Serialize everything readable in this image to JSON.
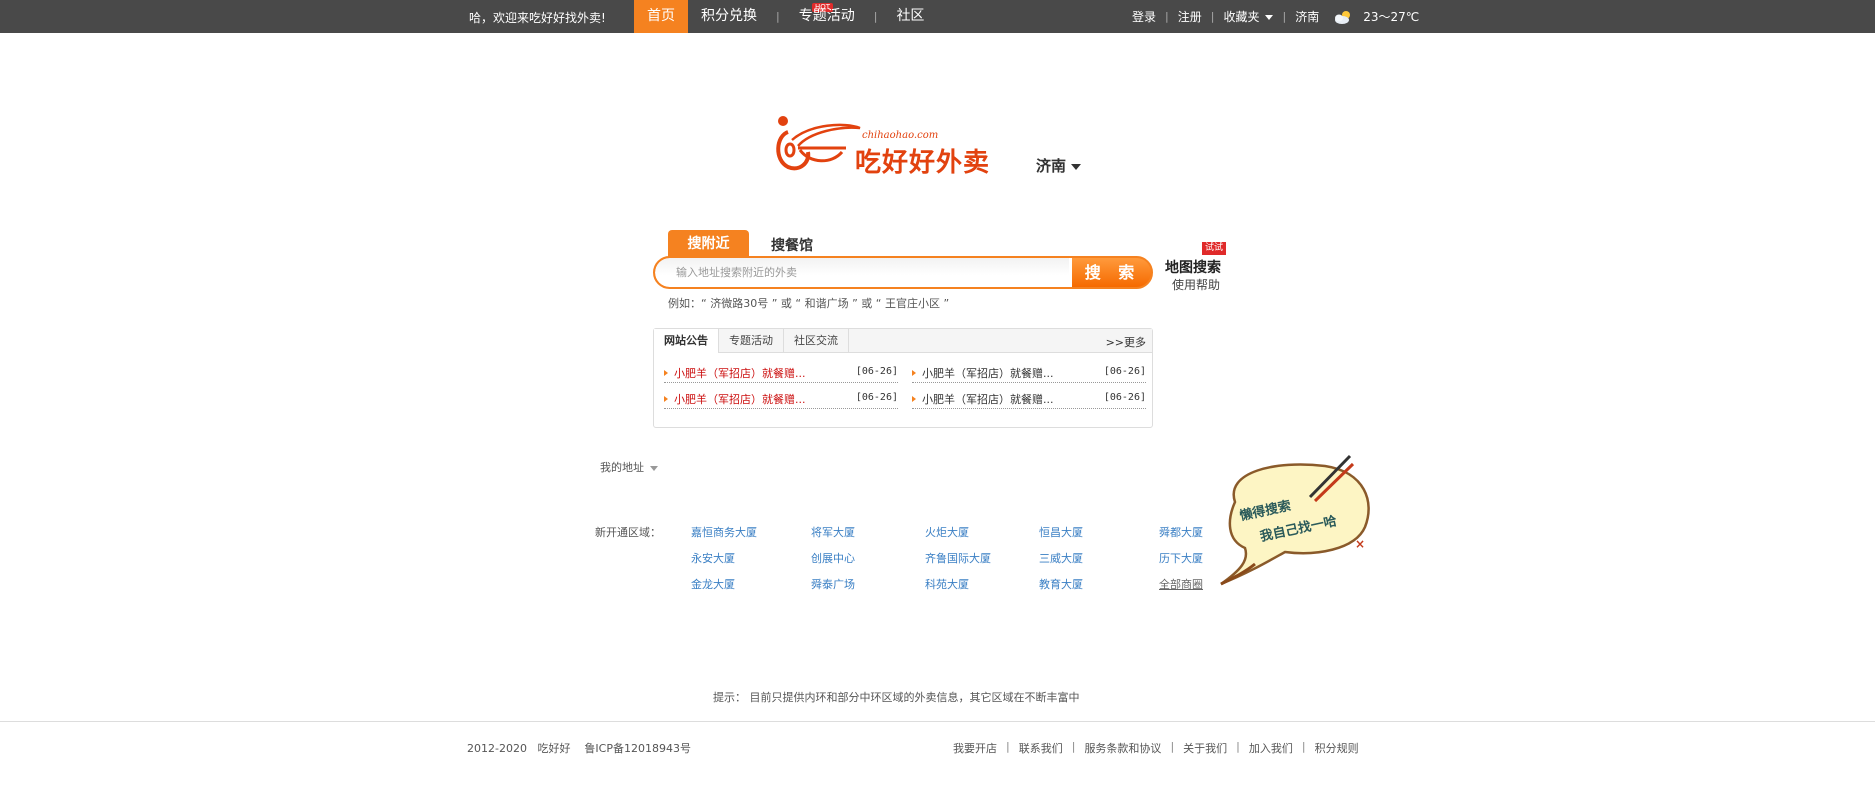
{
  "topbar": {
    "welcome": "哈，欢迎来吃好好找外卖!",
    "nav": [
      "首页",
      "积分兑换",
      "专题活动",
      "社区"
    ],
    "hot_badge": "HOT",
    "login": "登录",
    "register": "注册",
    "favorites": "收藏夹",
    "city": "济南",
    "temperature": "23～27℃"
  },
  "header": {
    "logo_domain": "chihaohao.com",
    "logo_text": "吃好好外卖",
    "city_select": "济南"
  },
  "search": {
    "tab_nearby": "搜附近",
    "tab_restaurant": "搜餐馆",
    "placeholder": "输入地址搜索附近的外卖",
    "button": "搜 索",
    "map_search": "地图搜索",
    "try_badge": "试试",
    "help": "使用帮助",
    "example": "例如：“ 济微路30号 ” 或 “ 和谐广场 ” 或 “ 王官庄小区 ”"
  },
  "notice": {
    "tabs": [
      "网站公告",
      "专题活动",
      "社区交流"
    ],
    "more": ">>更多",
    "items": [
      {
        "title": "小肥羊（军招店）就餐赠...",
        "date": "[06-26]"
      },
      {
        "title": "小肥羊（军招店）就餐赠...",
        "date": "[06-26]"
      },
      {
        "title": "小肥羊（军招店）就餐赠...",
        "date": "[06-26]"
      },
      {
        "title": "小肥羊（军招店）就餐赠...",
        "date": "[06-26]"
      }
    ]
  },
  "address": {
    "my_address": "我的地址",
    "new_area_label": "新开通区域：",
    "areas": [
      [
        "嘉恒商务大厦",
        "将军大厦",
        "火炬大厦",
        "恒昌大厦",
        "舜都大厦"
      ],
      [
        "永安大厦",
        "创展中心",
        "齐鲁国际大厦",
        "三威大厦",
        "历下大厦"
      ],
      [
        "金龙大厦",
        "舜泰广场",
        "科苑大厦",
        "教育大厦",
        "全部商圈"
      ]
    ],
    "bubble_line1": "懒得搜索",
    "bubble_line2": "我自己找一哈"
  },
  "footer": {
    "tip": "提示：  目前只提供内环和部分中环区域的外卖信息，其它区域在不断丰富中",
    "copyright": "2012-2020   吃好好    鲁ICP备12018943号",
    "links": [
      "我要开店",
      "联系我们",
      "服务条款和协议",
      "关于我们",
      "加入我们",
      "积分规则"
    ]
  },
  "colors": {
    "accent": "#f58220",
    "topbar": "#494949",
    "link": "#3a7fc4",
    "red": "#cc1010"
  }
}
